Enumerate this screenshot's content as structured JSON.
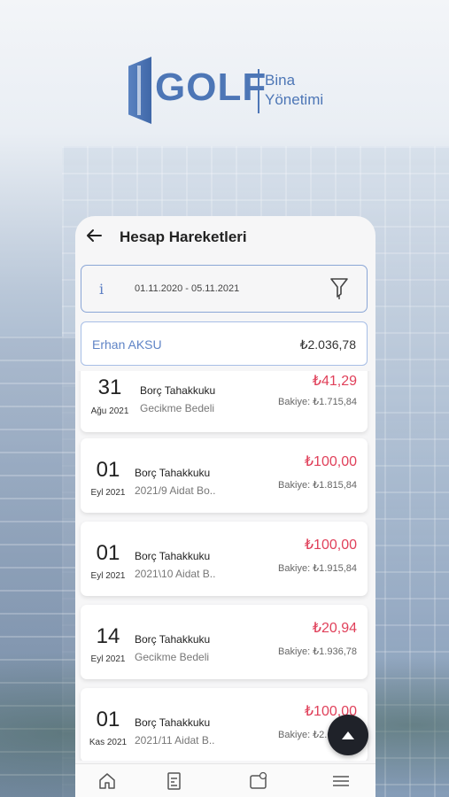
{
  "brand": {
    "name": "GOLF",
    "sub_line1": "Bina",
    "sub_line2": "Yönetimi"
  },
  "header": {
    "title": "Hesap Hareketleri",
    "back_icon": "arrow-left-icon"
  },
  "filter_bar": {
    "info_symbol": "i",
    "date_range": "01.11.2020 - 05.11.2021",
    "filter_icon": "funnel-icon"
  },
  "account": {
    "name": "Erhan AKSU",
    "total": "₺2.036,78"
  },
  "transactions": [
    {
      "day": "31",
      "month": "Ağu 2021",
      "type": "Borç Tahakkuku",
      "desc": "Gecikme Bedeli",
      "amount": "₺41,29",
      "balance": "Bakiye: ₺1.715,84"
    },
    {
      "day": "01",
      "month": "Eyl 2021",
      "type": "Borç Tahakkuku",
      "desc": "2021/9 Aidat Bo..",
      "amount": "₺100,00",
      "balance": "Bakiye: ₺1.815,84"
    },
    {
      "day": "01",
      "month": "Eyl 2021",
      "type": "Borç Tahakkuku",
      "desc": "2021\\10 Aidat B..",
      "amount": "₺100,00",
      "balance": "Bakiye: ₺1.915,84"
    },
    {
      "day": "14",
      "month": "Eyl 2021",
      "type": "Borç Tahakkuku",
      "desc": "Gecikme Bedeli",
      "amount": "₺20,94",
      "balance": "Bakiye: ₺1.936,78"
    },
    {
      "day": "01",
      "month": "Kas 2021",
      "type": "Borç Tahakkuku",
      "desc": "2021/11 Aidat B..",
      "amount": "₺100,00",
      "balance": "Bakiye: ₺2.036,78"
    }
  ],
  "scroll_top": {
    "icon": "arrow-up-icon"
  },
  "bottom_nav": [
    {
      "icon": "home-icon"
    },
    {
      "icon": "document-list-icon"
    },
    {
      "icon": "payment-card-icon"
    },
    {
      "icon": "menu-icon"
    }
  ],
  "colors": {
    "accent": "#5f84c6",
    "debit": "#e0405a",
    "fab": "#1f2229"
  }
}
